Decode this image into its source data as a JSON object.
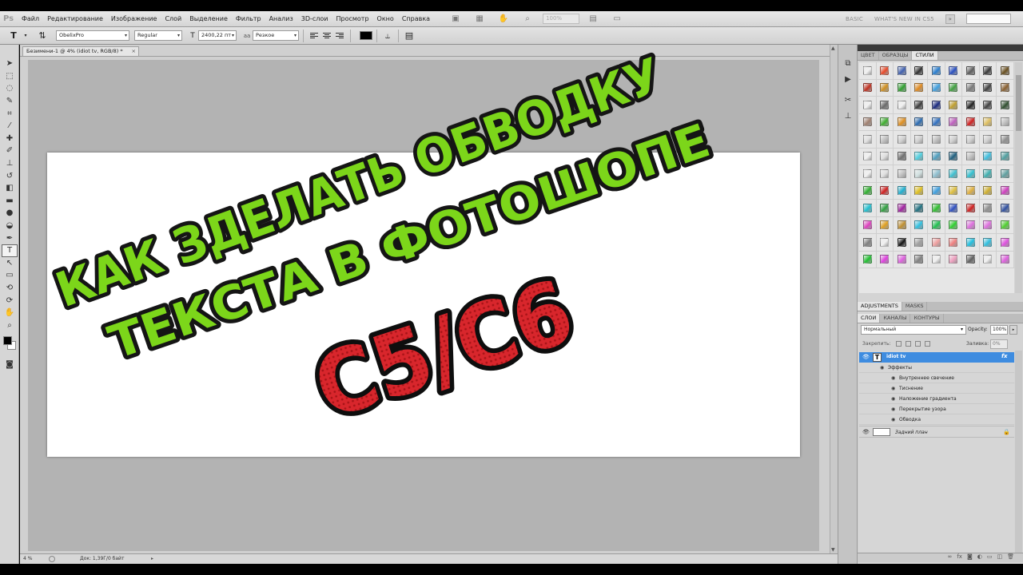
{
  "app": {
    "logo": "Ps"
  },
  "menu": [
    "Файл",
    "Редактирование",
    "Изображение",
    "Слой",
    "Выделение",
    "Фильтр",
    "Анализ",
    "3D-слои",
    "Просмотр",
    "Окно",
    "Справка"
  ],
  "menubar": {
    "zoom": "100%"
  },
  "workspace": {
    "basic": "BASIC",
    "whats_new": "WHAT'S NEW IN CS5",
    "arrow": "»"
  },
  "options": {
    "font_family": "ObelixPro",
    "font_style": "Regular",
    "font_size": "2400,22 пт",
    "antialias_label": "aa",
    "antialias": "Резкое",
    "text_color": "#000000"
  },
  "document": {
    "tab_title": "Безимени-1 @ 4% (idiot tv, RGB/8) *",
    "tab_close": "×",
    "artwork": {
      "line1": "КАК ЗДЕЛАТЬ ОБВОДКУ",
      "line2": "ТЕКСТА В ФОТОШОПЕ",
      "line3": "C5/C6",
      "green": "#7cd61a",
      "red": "#d8262c"
    }
  },
  "status": {
    "zoom": "4 %",
    "doc": "Док: 1,39Г/0 байт",
    "arrow": "▸"
  },
  "panels": {
    "color_tabs": [
      "ЦВЕТ",
      "ОБРАЗЦЫ",
      "СТИЛИ"
    ],
    "adjust_tabs": [
      "ADJUSTMENTS",
      "MASKS"
    ],
    "layer_tabs": [
      "СЛОИ",
      "КАНАЛЫ",
      "КОНТУРЫ"
    ],
    "blend_mode": "Нормальный",
    "opacity_label": "Opacity:",
    "opacity": "100%",
    "lock_label": "Закрепить:",
    "fill_label": "Заливка:",
    "fill": "0%",
    "layer_text": {
      "name": "idiot tv",
      "thumb": "T",
      "fx": "fx"
    },
    "effects_label": "Эффекты",
    "effects": [
      "Внутреннее свечение",
      "Тиснение",
      "Наложение градиента",
      "Перекрытие узора",
      "Обводка"
    ],
    "background_layer": "Задний план"
  },
  "style_swatches": [
    "#f0f0f0",
    "#e84a2a",
    "#4060b0",
    "#303030",
    "#2a7fd0",
    "#2a50c0",
    "#5c5c5c",
    "#3a3a3a",
    "#6a5020",
    "#c03020",
    "#d09020",
    "#30a030",
    "#e08a20",
    "#40a0e0",
    "#40a040",
    "#7a7a7a",
    "#404040",
    "#8a6030",
    "#f0f0f0",
    "#6a6a6a",
    "#f0f0f0",
    "#3a3a3a",
    "#1a2a80",
    "#c0a030",
    "#202020",
    "#404040",
    "#305030",
    "#a08070",
    "#40b030",
    "#e09020",
    "#2a6ab0",
    "#3070c0",
    "#c060c0",
    "#d02020",
    "#e0c060",
    "#c0c0c0",
    "#e0e0e0",
    "#c0c0c0",
    "#d0d0d0",
    "#d0d0d0",
    "#c0c0c0",
    "#d0d0d0",
    "#d0d0d0",
    "#d0d0d0",
    "#909090",
    "#f0f0f0",
    "#e0e0e0",
    "#707070",
    "#50d0e0",
    "#50a0c0",
    "#206080",
    "#c0c0c0",
    "#40c0e0",
    "#50a0a0",
    "#f0f0f0",
    "#e0e0e0",
    "#c0c0c0",
    "#d0e0e0",
    "#90c0d0",
    "#40c0d0",
    "#30c0d0",
    "#40b0b0",
    "#60a0a0",
    "#30b030",
    "#d02020",
    "#20b0d0",
    "#e0c020",
    "#40a0e0",
    "#e0c040",
    "#e0b040",
    "#d0b030",
    "#d040c0",
    "#20c0d0",
    "#30a040",
    "#a020a0",
    "#207080",
    "#30c030",
    "#3050c0",
    "#d02020",
    "#909090",
    "#3050a0",
    "#e040c0",
    "#e0a020",
    "#c09030",
    "#30c0e0",
    "#20c050",
    "#30d030",
    "#e070e0",
    "#e070e0",
    "#50d030",
    "#808080",
    "#f0f0f0",
    "#101010",
    "#a0a0a0",
    "#f0a0a0",
    "#f08080",
    "#20c0e0",
    "#30c0e0",
    "#e050e0",
    "#20c030",
    "#e040e0",
    "#e060e0",
    "#808080",
    "#f0f0f0",
    "#f0a0c0",
    "#606060",
    "#f0f0f0",
    "#e060e0"
  ]
}
